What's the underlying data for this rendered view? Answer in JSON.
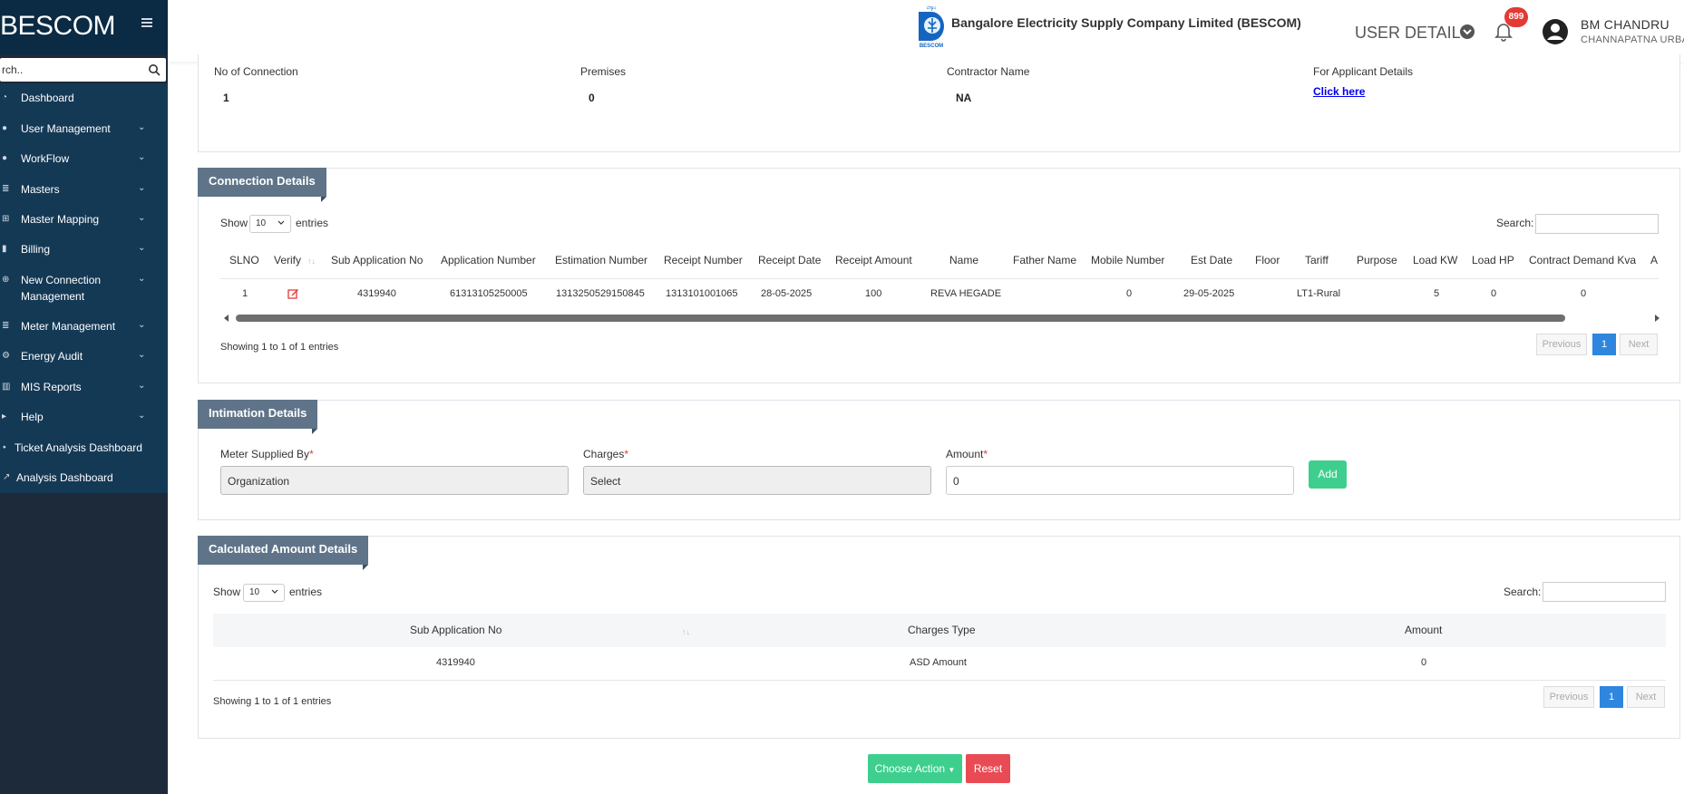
{
  "sidebar": {
    "brand": "BESCOM",
    "search_placeholder": "Search..",
    "search_value": "rch..",
    "items": [
      {
        "label": "Dashboard",
        "icon": "dashboard-icon",
        "has_children": false
      },
      {
        "label": "User Management",
        "icon": "user-icon",
        "has_children": true
      },
      {
        "label": "WorkFlow",
        "icon": "user-icon",
        "has_children": true
      },
      {
        "label": "Masters",
        "icon": "list-icon",
        "has_children": true
      },
      {
        "label": "Master Mapping",
        "icon": "sitemap-icon",
        "has_children": true
      },
      {
        "label": "Billing",
        "icon": "file-icon",
        "has_children": true
      },
      {
        "label": "New Connection",
        "label2": "Management",
        "icon": "plus-circle-icon",
        "has_children": true
      },
      {
        "label": "Meter Management",
        "icon": "list-icon",
        "has_children": true
      },
      {
        "label": "Energy Audit",
        "icon": "cogs-icon",
        "has_children": true
      },
      {
        "label": "MIS Reports",
        "icon": "bar-chart-icon",
        "has_children": true
      },
      {
        "label": "Help",
        "icon": "help-icon",
        "has_children": true
      },
      {
        "label": "Ticket Analysis Dashboard",
        "icon": "ticket-icon",
        "has_children": false
      },
      {
        "label": "Analysis Dashboard",
        "icon": "line-chart-icon",
        "has_children": false
      }
    ]
  },
  "header": {
    "company": "Bangalore Electricity Supply Company Limited (BESCOM)",
    "user_details_label": "USER DETAILS",
    "notification_count": "899",
    "user_name": "BM CHANDRU",
    "user_office": "CHANNAPATNA URBAN"
  },
  "summary": {
    "no_of_connection_label": "No of Connection",
    "no_of_connection_value": "1",
    "premises_label": "Premises",
    "premises_value": "0",
    "contractor_label": "Contractor Name",
    "contractor_value": "NA",
    "applicant_label": "For Applicant Details",
    "applicant_link": "Click here"
  },
  "connection_details": {
    "title": "Connection Details",
    "show_label": "Show",
    "entries_label": "entries",
    "page_length": "10",
    "search_label": "Search:",
    "columns": [
      "SLNO",
      "Verify",
      "Sub Application No",
      "Application Number",
      "Estimation Number",
      "Receipt Number",
      "Receipt Date",
      "Receipt Amount",
      "Name",
      "Father Name",
      "Mobile Number",
      "Est Date",
      "Floor",
      "Tariff",
      "Purpose",
      "Load KW",
      "Load HP",
      "Contract Demand Kva",
      "A"
    ],
    "rows": [
      {
        "slno": "1",
        "sub_app": "4319940",
        "app_no": "61313105250005",
        "est_no": "1313250529150845",
        "receipt_no": "1313101001065",
        "receipt_date": "28-05-2025",
        "receipt_amount": "100",
        "name": "REVA HEGADE",
        "father": "",
        "mobile": "0",
        "est_date": "29-05-2025",
        "floor": "",
        "tariff": "LT1-Rural",
        "purpose": "",
        "load_kw": "5",
        "load_hp": "0",
        "cd_kva": "0"
      }
    ],
    "info": "Showing 1 to 1 of 1 entries",
    "prev_label": "Previous",
    "page_label": "1",
    "next_label": "Next"
  },
  "intimation": {
    "title": "Intimation Details",
    "meter_label": "Meter Supplied By",
    "meter_value": "Organization",
    "charges_label": "Charges",
    "charges_value": "Select",
    "amount_label": "Amount",
    "amount_value": "0",
    "add_label": "Add"
  },
  "calculated": {
    "title": "Calculated Amount Details",
    "show_label": "Show",
    "entries_label": "entries",
    "page_length": "10",
    "search_label": "Search:",
    "columns": [
      "Sub Application No",
      "Charges Type",
      "Amount"
    ],
    "rows": [
      {
        "sub_app": "4319940",
        "charges_type": "ASD Amount",
        "amount": "0"
      }
    ],
    "info": "Showing 1 to 1 of 1 entries",
    "prev_label": "Previous",
    "page_label": "1",
    "next_label": "Next"
  },
  "actions": {
    "choose_label": "Choose Action",
    "reset_label": "Reset"
  },
  "colors": {
    "sidebar": "#1c2a3a",
    "menu": "#143955",
    "accent": "#3ecf8e",
    "danger": "#e94b55",
    "primary": "#2e86de",
    "badge": "#e53935"
  }
}
